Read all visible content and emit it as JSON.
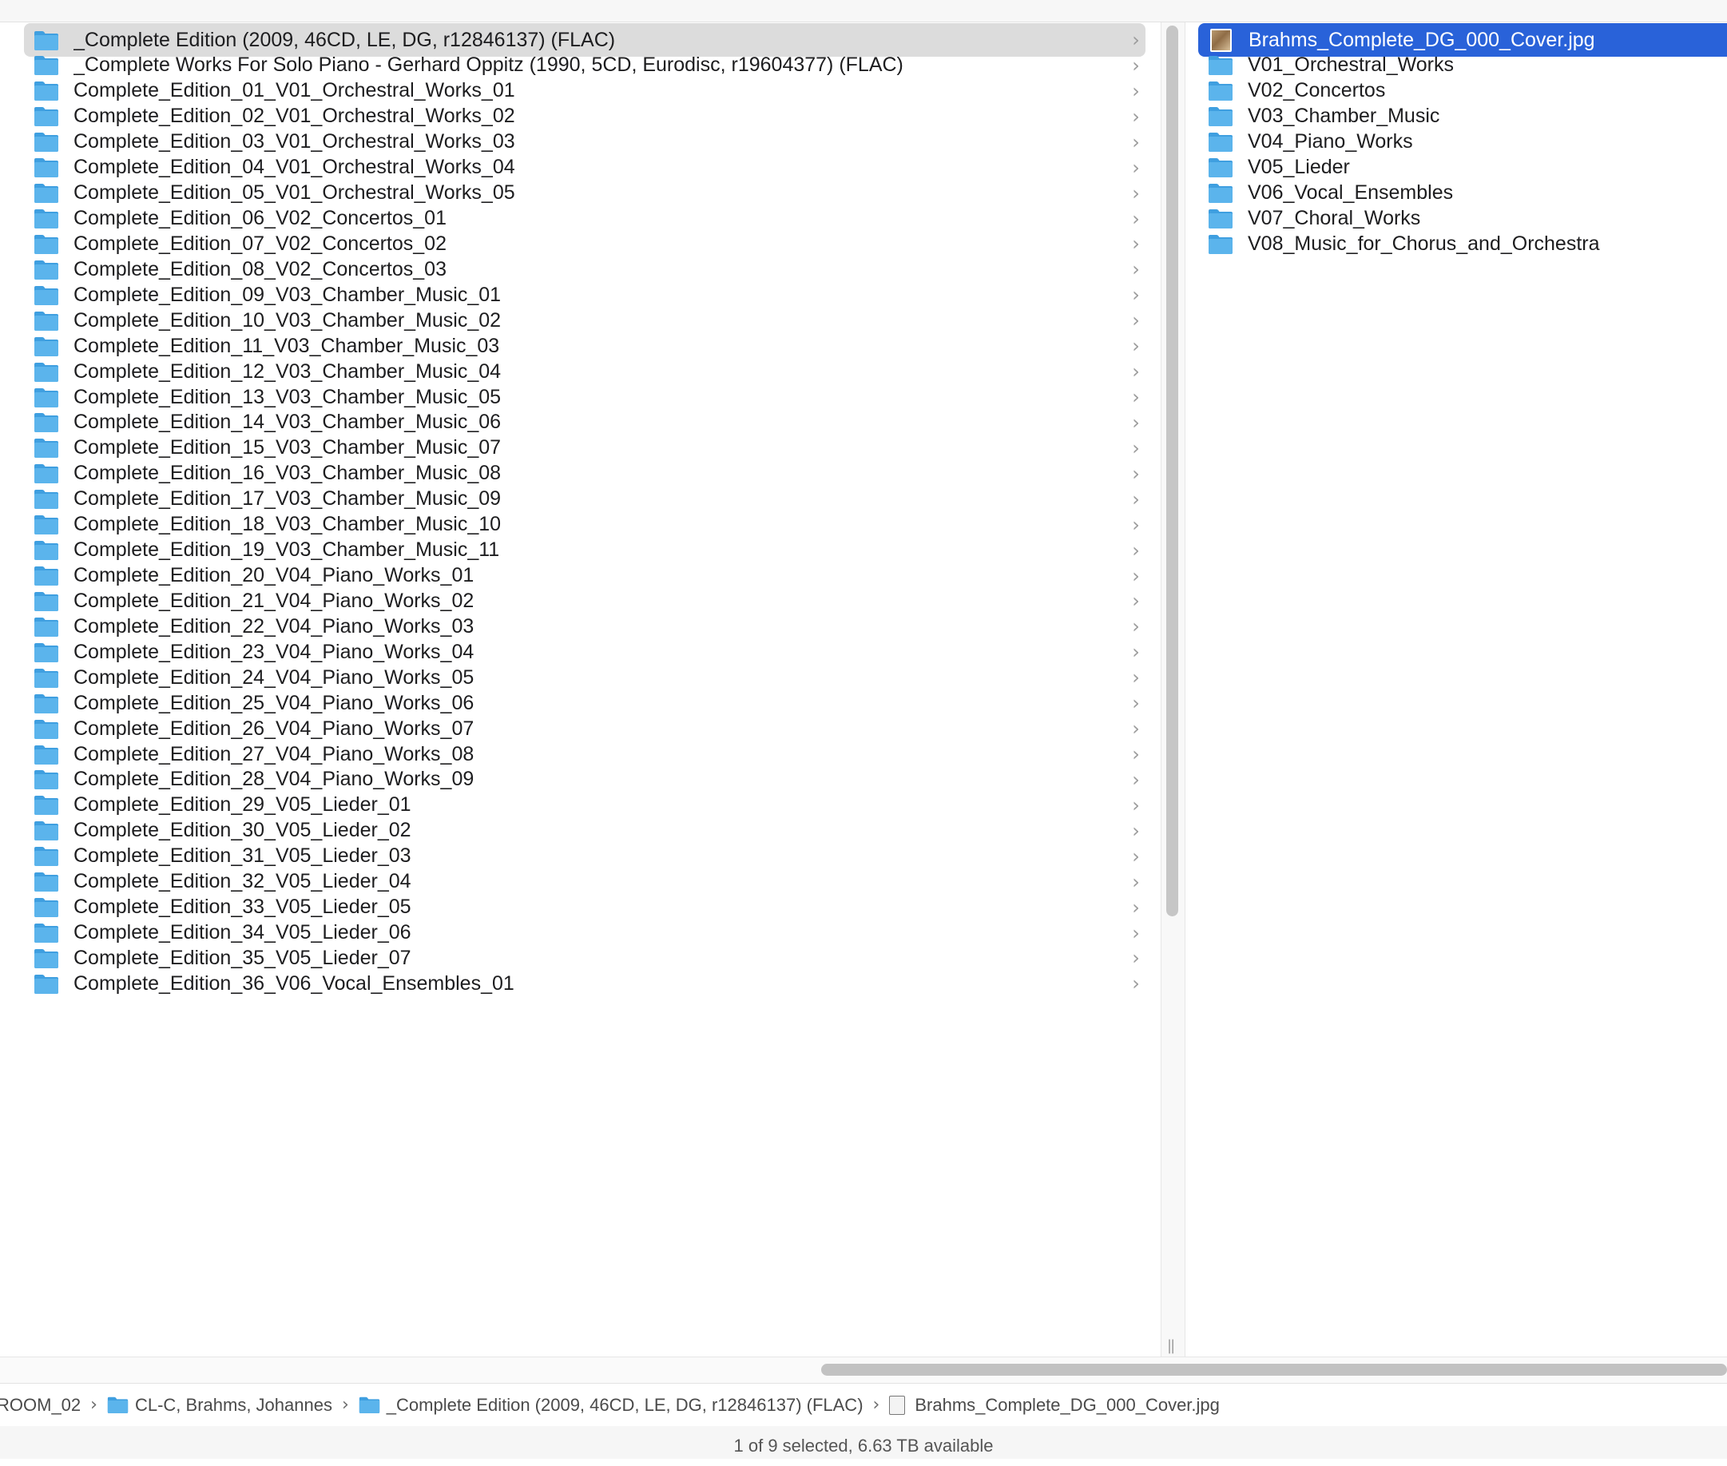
{
  "colors": {
    "selection_blue": "#2962d9",
    "selection_gray": "#dcdcdc",
    "folder_blue": "#5bb4ec"
  },
  "column1": {
    "items": [
      {
        "name": "_Complete Edition (2009, 46CD, LE, DG, r12846137) (FLAC)",
        "icon": "folder-icon",
        "selected": "gray"
      },
      {
        "name": "_Complete Works For Solo Piano - Gerhard Oppitz (1990, 5CD, Eurodisc, r19604377) (FLAC)",
        "icon": "folder-icon"
      },
      {
        "name": "Complete_Edition_01_V01_Orchestral_Works_01",
        "icon": "folder-icon"
      },
      {
        "name": "Complete_Edition_02_V01_Orchestral_Works_02",
        "icon": "folder-icon"
      },
      {
        "name": "Complete_Edition_03_V01_Orchestral_Works_03",
        "icon": "folder-icon"
      },
      {
        "name": "Complete_Edition_04_V01_Orchestral_Works_04",
        "icon": "folder-icon"
      },
      {
        "name": "Complete_Edition_05_V01_Orchestral_Works_05",
        "icon": "folder-icon"
      },
      {
        "name": "Complete_Edition_06_V02_Concertos_01",
        "icon": "folder-icon"
      },
      {
        "name": "Complete_Edition_07_V02_Concertos_02",
        "icon": "folder-icon"
      },
      {
        "name": "Complete_Edition_08_V02_Concertos_03",
        "icon": "folder-icon"
      },
      {
        "name": "Complete_Edition_09_V03_Chamber_Music_01",
        "icon": "folder-icon"
      },
      {
        "name": "Complete_Edition_10_V03_Chamber_Music_02",
        "icon": "folder-icon"
      },
      {
        "name": "Complete_Edition_11_V03_Chamber_Music_03",
        "icon": "folder-icon"
      },
      {
        "name": "Complete_Edition_12_V03_Chamber_Music_04",
        "icon": "folder-icon"
      },
      {
        "name": "Complete_Edition_13_V03_Chamber_Music_05",
        "icon": "folder-icon"
      },
      {
        "name": "Complete_Edition_14_V03_Chamber_Music_06",
        "icon": "folder-icon"
      },
      {
        "name": "Complete_Edition_15_V03_Chamber_Music_07",
        "icon": "folder-icon"
      },
      {
        "name": "Complete_Edition_16_V03_Chamber_Music_08",
        "icon": "folder-icon"
      },
      {
        "name": "Complete_Edition_17_V03_Chamber_Music_09",
        "icon": "folder-icon"
      },
      {
        "name": "Complete_Edition_18_V03_Chamber_Music_10",
        "icon": "folder-icon"
      },
      {
        "name": "Complete_Edition_19_V03_Chamber_Music_11",
        "icon": "folder-icon"
      },
      {
        "name": "Complete_Edition_20_V04_Piano_Works_01",
        "icon": "folder-icon"
      },
      {
        "name": "Complete_Edition_21_V04_Piano_Works_02",
        "icon": "folder-icon"
      },
      {
        "name": "Complete_Edition_22_V04_Piano_Works_03",
        "icon": "folder-icon"
      },
      {
        "name": "Complete_Edition_23_V04_Piano_Works_04",
        "icon": "folder-icon"
      },
      {
        "name": "Complete_Edition_24_V04_Piano_Works_05",
        "icon": "folder-icon"
      },
      {
        "name": "Complete_Edition_25_V04_Piano_Works_06",
        "icon": "folder-icon"
      },
      {
        "name": "Complete_Edition_26_V04_Piano_Works_07",
        "icon": "folder-icon"
      },
      {
        "name": "Complete_Edition_27_V04_Piano_Works_08",
        "icon": "folder-icon"
      },
      {
        "name": "Complete_Edition_28_V04_Piano_Works_09",
        "icon": "folder-icon"
      },
      {
        "name": "Complete_Edition_29_V05_Lieder_01",
        "icon": "folder-icon"
      },
      {
        "name": "Complete_Edition_30_V05_Lieder_02",
        "icon": "folder-icon"
      },
      {
        "name": "Complete_Edition_31_V05_Lieder_03",
        "icon": "folder-icon"
      },
      {
        "name": "Complete_Edition_32_V05_Lieder_04",
        "icon": "folder-icon"
      },
      {
        "name": "Complete_Edition_33_V05_Lieder_05",
        "icon": "folder-icon"
      },
      {
        "name": "Complete_Edition_34_V05_Lieder_06",
        "icon": "folder-icon"
      },
      {
        "name": "Complete_Edition_35_V05_Lieder_07",
        "icon": "folder-icon"
      },
      {
        "name": "Complete_Edition_36_V06_Vocal_Ensembles_01",
        "icon": "folder-icon"
      }
    ]
  },
  "column2": {
    "items": [
      {
        "name": "Brahms_Complete_DG_000_Cover.jpg",
        "icon": "image-file-icon",
        "selected": "blue"
      },
      {
        "name": "V01_Orchestral_Works",
        "icon": "folder-icon"
      },
      {
        "name": "V02_Concertos",
        "icon": "folder-icon"
      },
      {
        "name": "V03_Chamber_Music",
        "icon": "folder-icon"
      },
      {
        "name": "V04_Piano_Works",
        "icon": "folder-icon"
      },
      {
        "name": "V05_Lieder",
        "icon": "folder-icon"
      },
      {
        "name": "V06_Vocal_Ensembles",
        "icon": "folder-icon"
      },
      {
        "name": "V07_Choral_Works",
        "icon": "folder-icon"
      },
      {
        "name": "V08_Music_for_Chorus_and_Orchestra",
        "icon": "folder-icon"
      }
    ]
  },
  "pathbar": {
    "segments": [
      {
        "label": "ROOM_02",
        "icon": "none"
      },
      {
        "label": "CL-C, Brahms, Johannes",
        "icon": "folder-icon"
      },
      {
        "label": "_Complete Edition (2009, 46CD, LE, DG, r12846137) (FLAC)",
        "icon": "folder-icon"
      },
      {
        "label": "Brahms_Complete_DG_000_Cover.jpg",
        "icon": "image-file-icon"
      }
    ],
    "separator": "›"
  },
  "chevron": "›",
  "status": {
    "text": "1 of 9 selected, 6.63 TB available"
  }
}
